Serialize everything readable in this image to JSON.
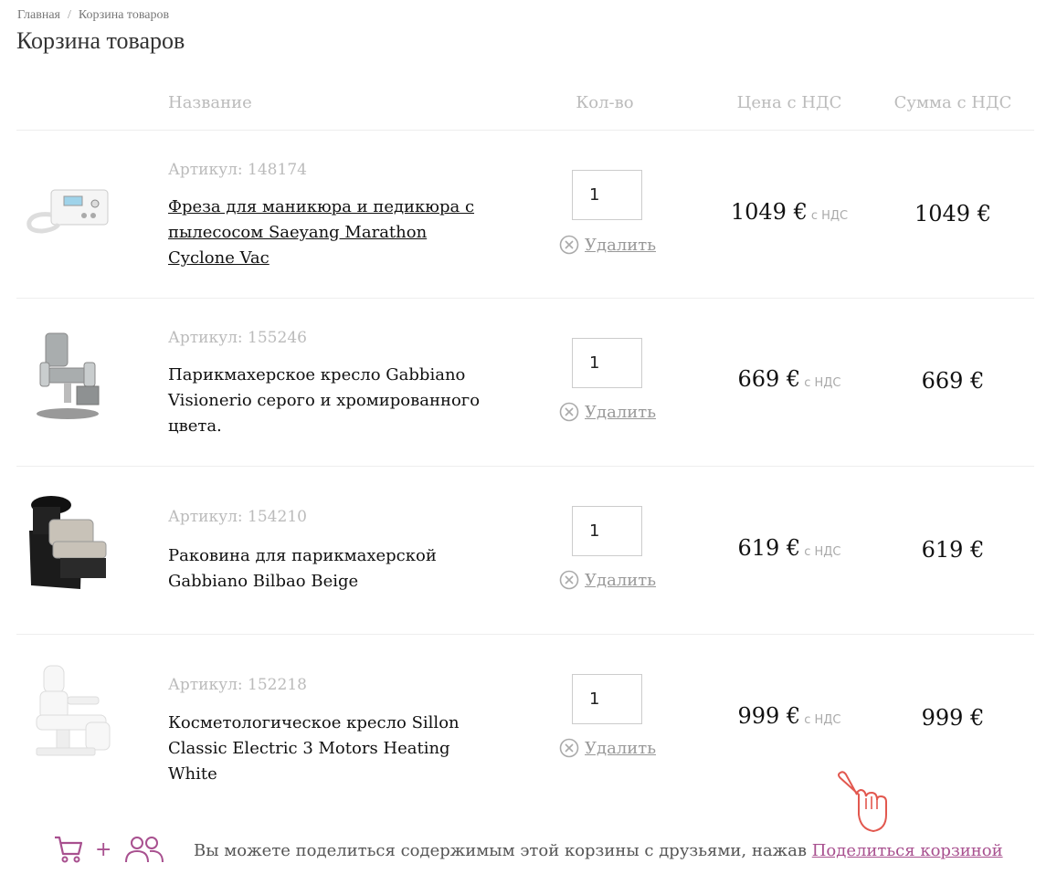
{
  "breadcrumb": {
    "home": "Главная",
    "separator": "/",
    "current": "Корзина товаров"
  },
  "page_title": "Корзина товаров",
  "table_headers": {
    "name": "Название",
    "qty": "Кол-во",
    "price": "Цена с НДС",
    "sum": "Сумма с НДС"
  },
  "items": [
    {
      "article": "Артикул: 148174",
      "name": "Фреза для маникюра и педикюра с пылесосом Saeyang Marathon Cyclone Vac",
      "qty": "1",
      "remove": "Удалить",
      "price": "1049 €",
      "vat": "с НДС",
      "sum": "1049 €",
      "image": "manicure-drill-device"
    },
    {
      "article": "Артикул: 155246",
      "name": "Парикмахерское кресло Gabbiano Visionerio серого и хромированного цвета.",
      "qty": "1",
      "remove": "Удалить",
      "price": "669 €",
      "vat": "с НДС",
      "sum": "669 €",
      "image": "barber-chair-grey"
    },
    {
      "article": "Артикул: 154210",
      "name": "Раковина для парикмахерской Gabbiano Bilbao Beige",
      "qty": "1",
      "remove": "Удалить",
      "price": "619 €",
      "vat": "с НДС",
      "sum": "619 €",
      "image": "wash-unit-beige"
    },
    {
      "article": "Артикул: 152218",
      "name": "Косметологическое кресло Sillon Classic Electric 3 Motors Heating White",
      "qty": "1",
      "remove": "Удалить",
      "price": "999 €",
      "vat": "с НДС",
      "sum": "999 €",
      "image": "cosmetic-chair-white"
    }
  ],
  "share": {
    "text": "Вы можете поделиться содержимым этой корзины с друзьями, нажав",
    "link": "Поделиться корзиной",
    "plus": "+"
  },
  "colors": {
    "accent": "#a8508f",
    "hand": "#e2584f"
  }
}
